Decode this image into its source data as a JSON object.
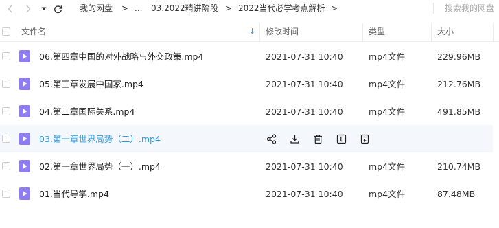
{
  "breadcrumb": {
    "items": [
      "我的网盘",
      "...",
      "03.2022精讲阶段",
      "2022当代必学考点解析"
    ],
    "separator": ">"
  },
  "search": {
    "placeholder": "搜索我的网盘"
  },
  "columns": {
    "name": "文件名",
    "modified": "修改时间",
    "type": "类型",
    "size": "大小"
  },
  "files": [
    {
      "name": "06.第四章中国的对外战略与外交政策.mp4",
      "modified": "2021-07-31 10:40",
      "type": "mp4文件",
      "size": "229.96MB"
    },
    {
      "name": "05.第三章发展中国家.mp4",
      "modified": "2021-07-31 10:40",
      "type": "mp4文件",
      "size": "212.76MB"
    },
    {
      "name": "04.第二章国际关系.mp4",
      "modified": "2021-07-31 10:40",
      "type": "mp4文件",
      "size": "491.85MB"
    },
    {
      "name": "03.第一章世界局势（二）.mp4",
      "modified": "",
      "type": "",
      "size": "",
      "hovered": true
    },
    {
      "name": "02.第一章世界局势（一）.mp4",
      "modified": "2021-07-31 10:40",
      "type": "mp4文件",
      "size": "210.74MB"
    },
    {
      "name": "01.当代导学.mp4",
      "modified": "2021-07-31 10:40",
      "type": "mp4文件",
      "size": "87.48MB"
    }
  ],
  "hover_actions": [
    "share-icon",
    "download-icon",
    "delete-icon",
    "rename-icon",
    "move-icon"
  ],
  "colors": {
    "accent": "#2a9fe6",
    "video_icon": "#8e7cf0",
    "hover_row": "#f4f8fd"
  }
}
